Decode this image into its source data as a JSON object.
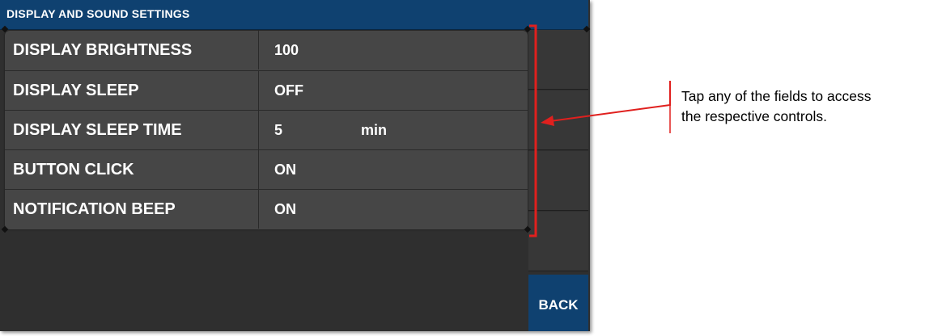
{
  "title_bar": {
    "title": "DISPLAY AND SOUND SETTINGS"
  },
  "settings": [
    {
      "label": "DISPLAY BRIGHTNESS",
      "value": "100",
      "unit": ""
    },
    {
      "label": "DISPLAY SLEEP",
      "value": "OFF",
      "unit": ""
    },
    {
      "label": "DISPLAY SLEEP TIME",
      "value": "5",
      "unit": "min"
    },
    {
      "label": "BUTTON CLICK",
      "value": "ON",
      "unit": ""
    },
    {
      "label": "NOTIFICATION BEEP",
      "value": "ON",
      "unit": ""
    }
  ],
  "back_button": {
    "label": "BACK"
  },
  "annotation": {
    "text": "Tap any of the fields to access\nthe respective controls."
  },
  "colors": {
    "title_bar": "#0f4170",
    "panel": "#464646",
    "background": "#2f2f2f",
    "annotation_red": "#e0201e"
  }
}
